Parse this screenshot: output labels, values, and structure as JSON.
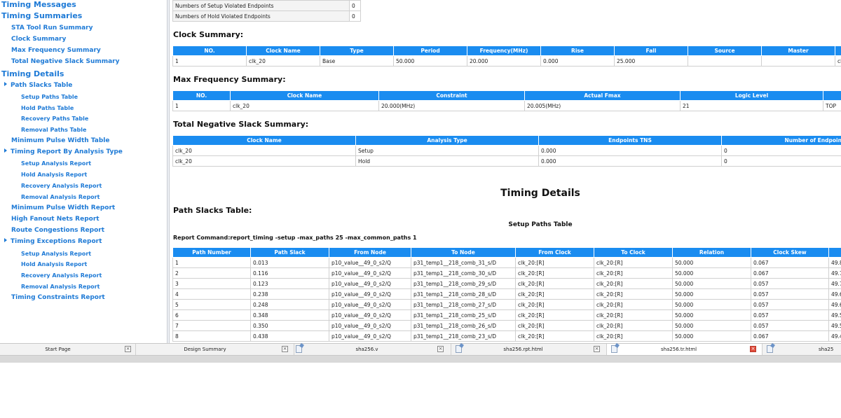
{
  "sidebar": {
    "items": [
      {
        "label": "Timing Messages",
        "level": 0
      },
      {
        "label": "Timing Summaries",
        "level": 0
      },
      {
        "label": "STA Tool Run Summary",
        "level": 1
      },
      {
        "label": "Clock Summary",
        "level": 1
      },
      {
        "label": "Max Frequency Summary",
        "level": 1
      },
      {
        "label": "Total Negative Slack Summary",
        "level": 1
      },
      {
        "label": "Timing Details",
        "level": 0
      },
      {
        "label": "Path Slacks Table",
        "level": 1,
        "expanded": true
      },
      {
        "label": "Setup Paths Table",
        "level": 2
      },
      {
        "label": "Hold Paths Table",
        "level": 2
      },
      {
        "label": "Recovery Paths Table",
        "level": 2
      },
      {
        "label": "Removal Paths Table",
        "level": 2
      },
      {
        "label": "Minimum Pulse Width Table",
        "level": 1
      },
      {
        "label": "Timing Report By Analysis Type",
        "level": 1,
        "expanded": true
      },
      {
        "label": "Setup Analysis Report",
        "level": 2
      },
      {
        "label": "Hold Analysis Report",
        "level": 2
      },
      {
        "label": "Recovery Analysis Report",
        "level": 2
      },
      {
        "label": "Removal Analysis Report",
        "level": 2
      },
      {
        "label": "Minimum Pulse Width Report",
        "level": 1
      },
      {
        "label": "High Fanout Nets Report",
        "level": 1
      },
      {
        "label": "Route Congestions Report",
        "level": 1
      },
      {
        "label": "Timing Exceptions Report",
        "level": 1,
        "expanded": true
      },
      {
        "label": "Setup Analysis Report",
        "level": 2
      },
      {
        "label": "Hold Analysis Report",
        "level": 2
      },
      {
        "label": "Recovery Analysis Report",
        "level": 2
      },
      {
        "label": "Removal Analysis Report",
        "level": 2
      },
      {
        "label": "Timing Constraints Report",
        "level": 1
      }
    ]
  },
  "top_table": {
    "rows": [
      [
        "Numbers of Setup Violated Endpoints",
        "0"
      ],
      [
        "Numbers of Hold Violated Endpoints",
        "0"
      ]
    ]
  },
  "clock_summary": {
    "title": "Clock Summary:",
    "headers": [
      "NO.",
      "Clock Name",
      "Type",
      "Period",
      "Frequency(MHz)",
      "Rise",
      "Fall",
      "Source",
      "Master",
      ""
    ],
    "rows": [
      [
        "1",
        "clk_20",
        "Base",
        "50.000",
        "20.000",
        "0.000",
        "25.000",
        "",
        "",
        "cl"
      ]
    ]
  },
  "max_freq": {
    "title": "Max Frequency Summary:",
    "headers": [
      "NO.",
      "Clock Name",
      "Constraint",
      "Actual Fmax",
      "Logic Level",
      ""
    ],
    "rows": [
      [
        "1",
        "clk_20",
        "20.000(MHz)",
        "20.005(MHz)",
        "21",
        "TOP"
      ]
    ]
  },
  "tns": {
    "title": "Total Negative Slack Summary:",
    "headers": [
      "Clock Name",
      "Analysis Type",
      "Endpoints TNS",
      "Number of Endpoints"
    ],
    "rows": [
      [
        "clk_20",
        "Setup",
        "0.000",
        "0"
      ],
      [
        "clk_20",
        "Hold",
        "0.000",
        "0"
      ]
    ]
  },
  "timing_details": {
    "title": "Timing Details",
    "path_slacks_title": "Path Slacks Table:",
    "setup_paths_title": "Setup Paths Table",
    "report_command": "Report Command:report_timing -setup -max_paths 25 -max_common_paths 1"
  },
  "setup_paths": {
    "headers": [
      "Path Number",
      "Path Slack",
      "From Node",
      "To Node",
      "From Clock",
      "To Clock",
      "Relation",
      "Clock Skew",
      ""
    ],
    "rows": [
      [
        "1",
        "0.013",
        "p10_value__49_0_s2/Q",
        "p31_temp1__218_comb_31_s/D",
        "clk_20:[R]",
        "clk_20:[R]",
        "50.000",
        "0.067",
        "49.8"
      ],
      [
        "2",
        "0.116",
        "p10_value__49_0_s2/Q",
        "p31_temp1__218_comb_30_s/D",
        "clk_20:[R]",
        "clk_20:[R]",
        "50.000",
        "0.067",
        "49.7"
      ],
      [
        "3",
        "0.123",
        "p10_value__49_0_s2/Q",
        "p31_temp1__218_comb_29_s/D",
        "clk_20:[R]",
        "clk_20:[R]",
        "50.000",
        "0.057",
        "49.7"
      ],
      [
        "4",
        "0.238",
        "p10_value__49_0_s2/Q",
        "p31_temp1__218_comb_28_s/D",
        "clk_20:[R]",
        "clk_20:[R]",
        "50.000",
        "0.057",
        "49.6"
      ],
      [
        "5",
        "0.248",
        "p10_value__49_0_s2/Q",
        "p31_temp1__218_comb_27_s/D",
        "clk_20:[R]",
        "clk_20:[R]",
        "50.000",
        "0.057",
        "49.6"
      ],
      [
        "6",
        "0.348",
        "p10_value__49_0_s2/Q",
        "p31_temp1__218_comb_25_s/D",
        "clk_20:[R]",
        "clk_20:[R]",
        "50.000",
        "0.057",
        "49.5"
      ],
      [
        "7",
        "0.350",
        "p10_value__49_0_s2/Q",
        "p31_temp1__218_comb_26_s/D",
        "clk_20:[R]",
        "clk_20:[R]",
        "50.000",
        "0.057",
        "49.5"
      ],
      [
        "8",
        "0.438",
        "p10_value__49_0_s2/Q",
        "p31_temp1__218_comb_23_s/D",
        "clk_20:[R]",
        "clk_20:[R]",
        "50.000",
        "0.067",
        "49.4"
      ]
    ]
  },
  "tabs": [
    {
      "label": "Start Page",
      "doc": false,
      "active": false
    },
    {
      "label": "Design Summary",
      "doc": false,
      "active": false
    },
    {
      "label": "sha256.v",
      "doc": true,
      "active": false
    },
    {
      "label": "sha256.rpt.html",
      "doc": true,
      "active": false
    },
    {
      "label": "sha256.tr.html",
      "doc": true,
      "active": true
    },
    {
      "label": "sha25",
      "doc": true,
      "active": false
    }
  ],
  "colors": {
    "link": "#1e7ad6",
    "header_bg": "#1a8cf0",
    "active_close": "#e04a3a"
  }
}
